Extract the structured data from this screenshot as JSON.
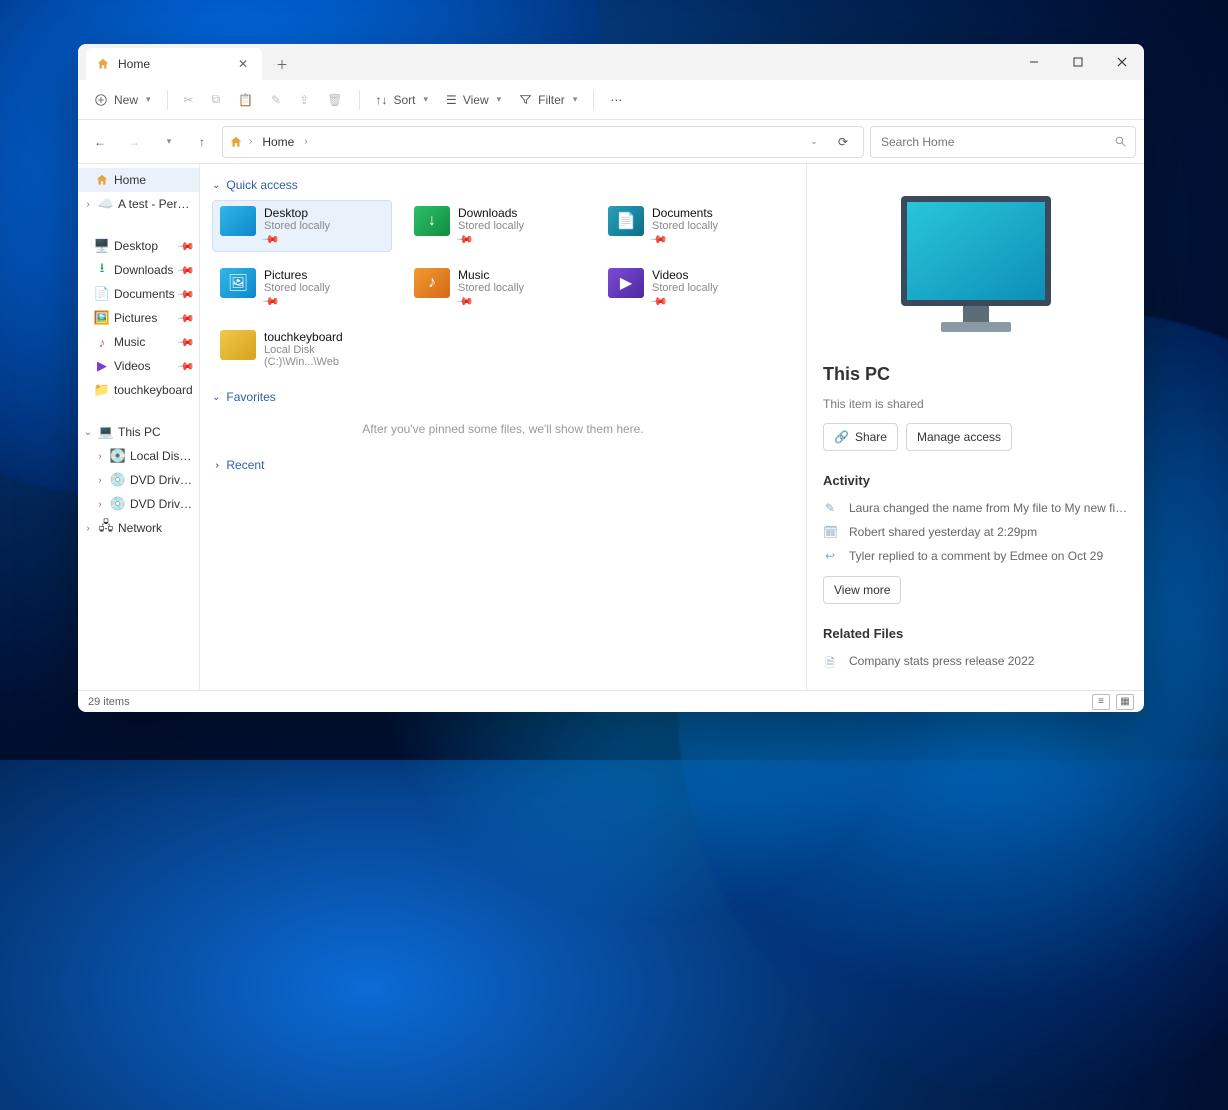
{
  "tab": {
    "title": "Home"
  },
  "toolbar": {
    "new": "New",
    "sort": "Sort",
    "view": "View",
    "filter": "Filter"
  },
  "addressbar": {
    "crumb1": "Home"
  },
  "search": {
    "placeholder": "Search Home"
  },
  "sidebar": {
    "home": "Home",
    "atest": "A test - Personal",
    "desktop": "Desktop",
    "downloads": "Downloads",
    "documents": "Documents",
    "pictures": "Pictures",
    "music": "Music",
    "videos": "Videos",
    "touchkeyboard": "touchkeyboard",
    "thispc": "This PC",
    "localdisk": "Local Disk (C:)",
    "dvdd": "DVD Drive (D:) CC",
    "dvdd2": "DVD Drive (D:) CCC",
    "network": "Network"
  },
  "sections": {
    "quick": "Quick access",
    "favorites": "Favorites",
    "fav_empty": "After you've pinned some files, we'll show them here.",
    "recent": "Recent"
  },
  "quick": [
    {
      "name": "Desktop",
      "sub": "Stored locally",
      "color": "c-blue",
      "glyph": ""
    },
    {
      "name": "Downloads",
      "sub": "Stored locally",
      "color": "c-green",
      "glyph": "↓"
    },
    {
      "name": "Documents",
      "sub": "Stored locally",
      "color": "c-teal",
      "glyph": "📄"
    },
    {
      "name": "Pictures",
      "sub": "Stored locally",
      "color": "c-blue",
      "glyph": "🖼"
    },
    {
      "name": "Music",
      "sub": "Stored locally",
      "color": "c-orange",
      "glyph": "♪"
    },
    {
      "name": "Videos",
      "sub": "Stored locally",
      "color": "c-purple",
      "glyph": "▶"
    },
    {
      "name": "touchkeyboard",
      "sub": "Local Disk (C:)\\Win...\\Web",
      "color": "c-yellow",
      "glyph": "",
      "nopin": true
    }
  ],
  "details": {
    "title": "This PC",
    "shared": "This item is shared",
    "share": "Share",
    "manage": "Manage access",
    "activity_hd": "Activity",
    "activities": [
      "Laura changed the name from My file to My new file with a long nan",
      "Robert shared yesterday at 2:29pm",
      "Tyler replied to a comment by Edmee on Oct 29"
    ],
    "viewmore": "View more",
    "related_hd": "Related Files",
    "related": "Company stats press release 2022"
  },
  "statusbar": {
    "count": "29 items"
  }
}
